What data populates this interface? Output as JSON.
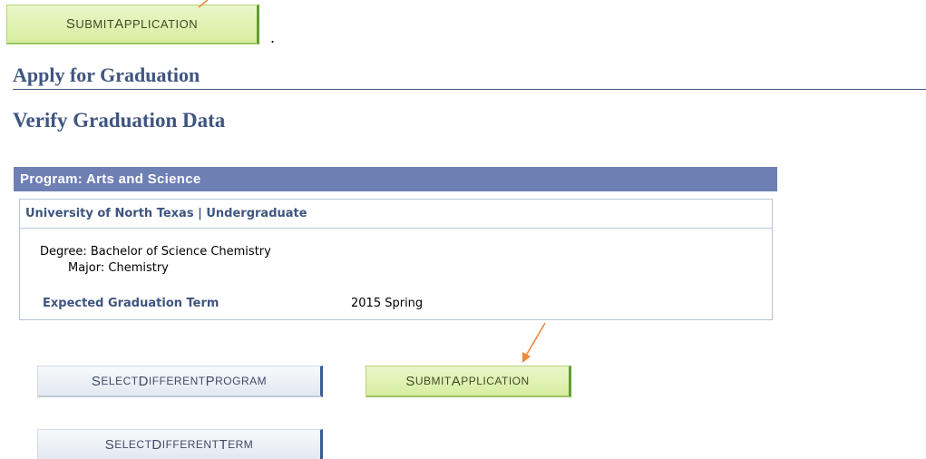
{
  "top_button": {
    "first": "S",
    "rest": "ubmit ",
    "first2": "A",
    "rest2": "pplication"
  },
  "dot": ".",
  "page_heading": "Apply for Graduation",
  "sub_heading": "Verify Graduation Data",
  "program": {
    "header": "Program: Arts and Science",
    "institution": "University of North Texas | Undergraduate",
    "degree_line": "Degree: Bachelor of Science Chemistry",
    "major_line": "Major: Chemistry",
    "term_label": "Expected Graduation Term",
    "term_value": "2015 Spring"
  },
  "buttons": {
    "select_program": {
      "a": "S",
      "b": "elect ",
      "c": "D",
      "d": "ifferent ",
      "e": "P",
      "f": "rogram"
    },
    "submit": {
      "a": "S",
      "b": "ubmit ",
      "c": "A",
      "d": "pplication"
    },
    "select_term": {
      "a": "S",
      "b": "elect ",
      "c": "D",
      "d": "ifferent ",
      "e": "T",
      "f": "erm"
    }
  },
  "colors": {
    "arrow": "#f0873a",
    "heading": "#3f5580",
    "header_bg": "#6e7fb3"
  },
  "icons": [
    "arrow-icon"
  ]
}
